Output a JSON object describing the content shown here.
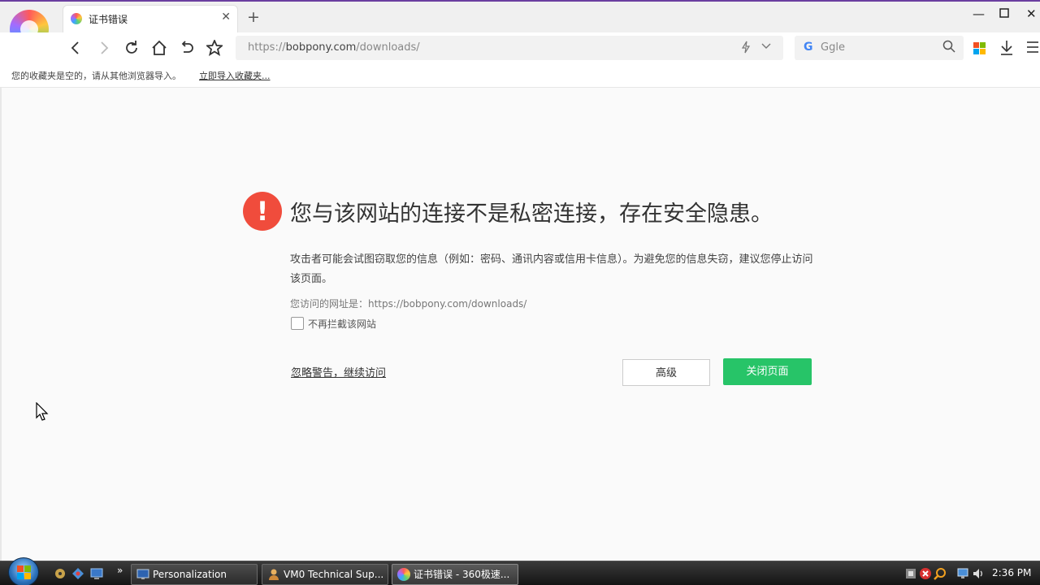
{
  "browser": {
    "tab_title": "证书错误",
    "url_scheme": "https://",
    "url_host": "bobpony.com",
    "url_path": "/downloads/",
    "search_placeholder": "Ggle"
  },
  "bookmarks": {
    "empty_text": "您的收藏夹是空的，请从其他浏览器导入。",
    "import_link": "立即导入收藏夹..."
  },
  "warning": {
    "headline": "您与该网站的连接不是私密连接，存在安全隐患。",
    "description": "攻击者可能会试图窃取您的信息（例如：密码、通讯内容或信用卡信息）。为避免您的信息失窃，建议您停止访问该页面。",
    "visit_url": "您访问的网址是：https://bobpony.com/downloads/",
    "checkbox_label": "不再拦截该网站",
    "ignore_link": "忽略警告，继续访问",
    "advanced_button": "高级",
    "close_button": "关闭页面",
    "colors": {
      "danger": "#f04c3c",
      "primary": "#27c468"
    }
  },
  "taskbar": {
    "items": [
      {
        "label": "Personalization",
        "icon": "monitor-icon"
      },
      {
        "label": "VM0 Technical Sup...",
        "icon": "user-icon"
      },
      {
        "label": "证书错误 - 360极速...",
        "icon": "browser-360-icon",
        "active": true
      }
    ],
    "clock": "2:36 PM"
  }
}
